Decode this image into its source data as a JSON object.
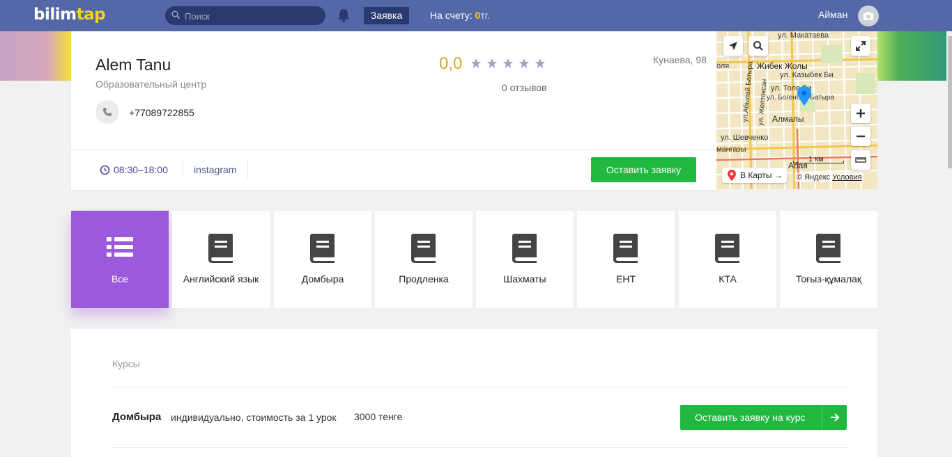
{
  "header": {
    "logo_part1": "bilim",
    "logo_part2": "tap",
    "search_placeholder": "Поиск",
    "request_label": "Заявка",
    "balance_label": "На счету:",
    "balance_value": "0",
    "balance_currency": "тг.",
    "user_name": "Айман"
  },
  "profile": {
    "name": "Alem Tanu",
    "subtitle": "Образовательный центр",
    "phone": "+77089722855",
    "rating": "0,0",
    "stars_filled": 0,
    "stars_total": 5,
    "reviews": "0 отзывов",
    "address": "Кунаева, 98",
    "hours": "08:30–18:00",
    "instagram": "instagram",
    "cta_label": "Оставить заявку"
  },
  "map": {
    "labels": {
      "makataeva": "ул. Макатаева",
      "zhibek": "Жибек Жолы",
      "kazybek": "ул. Казыбек Би",
      "tole": "ул. Толе Би",
      "bogen": "ул. Богенбай Батыра",
      "almaly": "Алмалы",
      "shevchenko": "ул. Шевченко",
      "mangazy": "мангазы",
      "abaya": "Абая",
      "olya": "оля",
      "zheltoksan": "ул. Желтоксан",
      "ablai": "ул.Абылай Батыра"
    },
    "scale": "1 км",
    "open_maps": "В Карты →",
    "copyright": "© Яндекс",
    "terms": "Условия"
  },
  "categories": [
    {
      "label": "Все",
      "icon": "list-icon",
      "active": true
    },
    {
      "label": "Английский язык",
      "icon": "book-icon"
    },
    {
      "label": "Домбыра",
      "icon": "book-icon"
    },
    {
      "label": "Продленка",
      "icon": "book-icon"
    },
    {
      "label": "Шахматы",
      "icon": "book-icon"
    },
    {
      "label": "ЕНТ",
      "icon": "book-icon"
    },
    {
      "label": "КТА",
      "icon": "book-icon"
    },
    {
      "label": "Тоғыз-құмалақ",
      "icon": "book-icon"
    }
  ],
  "courses": {
    "title": "Курсы",
    "items": [
      {
        "name": "Домбыра",
        "description": "индивидуально, стоимость за 1 урок",
        "price": "3000 тенге",
        "button": "Оставить заявку на курс"
      }
    ]
  },
  "colors": {
    "header_bg": "#5468a8",
    "accent_green": "#20b83f",
    "active_purple": "#9b59db",
    "rating_gold": "#d9a821"
  }
}
